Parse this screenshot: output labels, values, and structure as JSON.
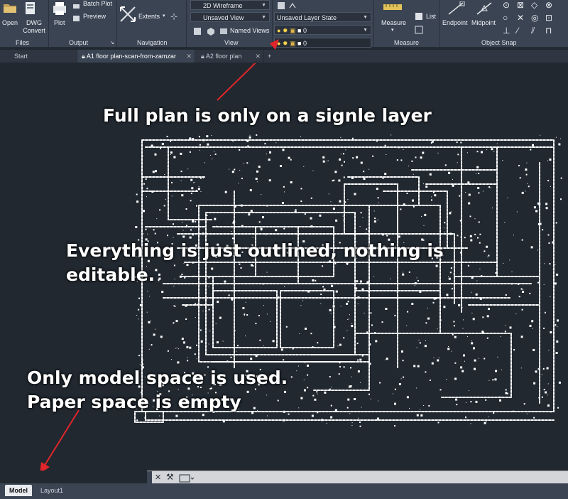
{
  "ribbon": {
    "files": {
      "open_label": "Open",
      "dwg_convert_label": "DWG\nConvert",
      "panel_label": "Files"
    },
    "output": {
      "plot_label": "Plot",
      "batch_plot_label": "Batch Plot",
      "preview_label": "Preview",
      "panel_label": "Output"
    },
    "navigation": {
      "extents_label": "Extents",
      "panel_label": "Navigation"
    },
    "view": {
      "visual_style": "2D Wireframe",
      "saved_view": "Unsaved View",
      "named_views_label": "Named Views",
      "panel_label": "View"
    },
    "layers": {
      "layer_state": "Unsaved Layer State",
      "current_layer": "0",
      "dropdown_layer": "0"
    },
    "measure": {
      "measure_label": "Measure",
      "list_label": "List",
      "panel_label": "Measure"
    },
    "object_snap": {
      "endpoint_label": "Endpoint",
      "midpoint_label": "Midpoint",
      "panel_label": "Object Snap"
    }
  },
  "tabs": [
    {
      "label": "Start"
    },
    {
      "label": "A1 floor plan-scan-from-zamzar"
    },
    {
      "label": "A2 floor plan"
    }
  ],
  "annotations": {
    "layer_note": "Full plan is only on a signle layer",
    "outline_note_line1": "Everything is just outlined, nothing is",
    "outline_note_line2": "editable.",
    "space_note_line1": "Only model space is used.",
    "space_note_line2": "Paper space is empty"
  },
  "layout_tabs": {
    "model": "Model",
    "layout1": "Layout1"
  },
  "colors": {
    "arrow": "#e0262a",
    "canvas_bg": "#212830",
    "ribbon_bg": "#3b4453"
  }
}
